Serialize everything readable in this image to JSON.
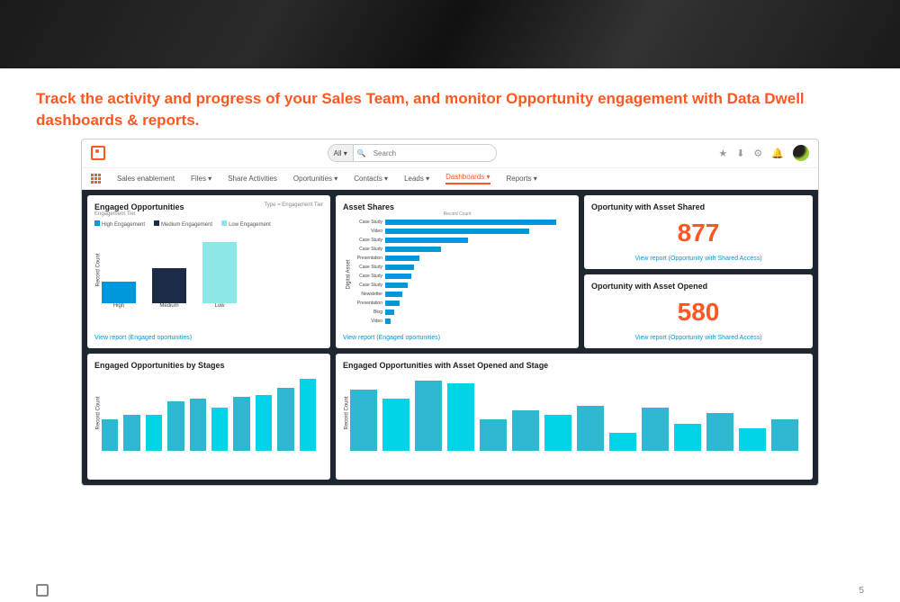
{
  "headline": "Track the activity and progress of your Sales Team, and monitor Opportunity engagement with Data Dwell dashboards & reports.",
  "page_number": "5",
  "topbar": {
    "search_all": "All ▾",
    "search_placeholder": "Search"
  },
  "nav": {
    "sales_enablement": "Sales enablement",
    "files": "Files ▾",
    "share_activities": "Share Activities",
    "opportunities": "Oportunities ▾",
    "contacts": "Contacts ▾",
    "leads": "Leads ▾",
    "dashboards": "Dashboards ▾",
    "reports": "Reports ▾"
  },
  "cards": {
    "engaged": {
      "title": "Engaged Opportunities",
      "sub_right": "Type = Engagement Tier",
      "sub_left": "Engagement Tier",
      "legend": {
        "high": "High Engagement",
        "medium": "Medium Engagement",
        "low": "Low Engagement"
      },
      "ylabel": "Record Count",
      "xlabels": {
        "high": "High",
        "medium": "Medium",
        "low": "Low"
      },
      "link": "View report (Engaged oportunities)"
    },
    "asset_shares": {
      "title": "Asset Shares",
      "axis_top": "Record Count",
      "ylabel": "Digital Asset",
      "link": "View report (Engaged oportunities)"
    },
    "metric1": {
      "title": "Oportunity with Asset Shared",
      "value": "877",
      "link": "View report (Opportunity with Shared Access)"
    },
    "metric2": {
      "title": "Oportunity with Asset Opened",
      "value": "580",
      "link": "View report (Opportunity with Shared Access)"
    },
    "stages": {
      "title": "Engaged Opportunities by Stages",
      "ylabel": "Record Count"
    },
    "opened_stage": {
      "title": "Engaged Opportunities with Asset Opened and Stage",
      "ylabel": "Record Count"
    }
  },
  "chart_data": [
    {
      "type": "bar",
      "id": "engaged_opportunities",
      "title": "Engaged Opportunities",
      "ylabel": "Record Count",
      "categories": [
        "High",
        "Medium",
        "Low"
      ],
      "series": [
        {
          "name": "High Engagement",
          "color": "#0098db",
          "values": [
            90,
            null,
            null
          ]
        },
        {
          "name": "Medium Engagement",
          "color": "#1e2b47",
          "values": [
            null,
            145,
            null
          ]
        },
        {
          "name": "Low Engagement",
          "color": "#8ee7e7",
          "values": [
            null,
            null,
            255
          ]
        }
      ],
      "ylim": [
        0,
        300
      ]
    },
    {
      "type": "bar",
      "id": "asset_shares",
      "orientation": "horizontal",
      "title": "Asset Shares",
      "xlabel": "Record Count",
      "ylabel": "Digital Asset",
      "categories": [
        "Case Study",
        "Video",
        "Case Study",
        "Case Study",
        "Presentation",
        "Case Study",
        "Case Study",
        "Case Study",
        "Newsletter",
        "Presentation",
        "Blog",
        "Video"
      ],
      "values": [
        300,
        252,
        145,
        98,
        60,
        50,
        45,
        40,
        30,
        25,
        15,
        10
      ],
      "xlim": [
        0,
        320
      ],
      "color": "#0098db"
    },
    {
      "type": "bar",
      "id": "engaged_by_stages",
      "title": "Engaged Opportunities by Stages",
      "ylabel": "Record Count",
      "categories": [
        "1",
        "2",
        "3",
        "4",
        "5",
        "6",
        "7",
        "8",
        "9",
        "10"
      ],
      "values": [
        35,
        40,
        40,
        55,
        58,
        48,
        60,
        62,
        70,
        80
      ],
      "ylim": [
        0,
        90
      ],
      "colors": [
        "#2fb6d0",
        "#2fb6d0",
        "#00d4e6",
        "#2fb6d0",
        "#2fb6d0",
        "#00d4e6",
        "#2fb6d0",
        "#00d4e6",
        "#2fb6d0",
        "#00d4e6"
      ]
    },
    {
      "type": "bar",
      "id": "opened_and_stage",
      "title": "Engaged Opportunities with Asset Opened and Stage",
      "ylabel": "Record Count",
      "categories": [
        "1",
        "2",
        "3",
        "4",
        "5",
        "6",
        "7",
        "8",
        "9",
        "10",
        "11",
        "12",
        "13",
        "14"
      ],
      "values": [
        68,
        58,
        78,
        75,
        35,
        45,
        40,
        50,
        20,
        48,
        30,
        42,
        25,
        35
      ],
      "ylim": [
        0,
        90
      ],
      "colors": [
        "#2fb6d0",
        "#00d4e6",
        "#2fb6d0",
        "#00d4e6",
        "#2fb6d0",
        "#2fb6d0",
        "#00d4e6",
        "#2fb6d0",
        "#00d4e6",
        "#2fb6d0",
        "#00d4e6",
        "#2fb6d0",
        "#00d4e6",
        "#2fb6d0"
      ]
    }
  ]
}
